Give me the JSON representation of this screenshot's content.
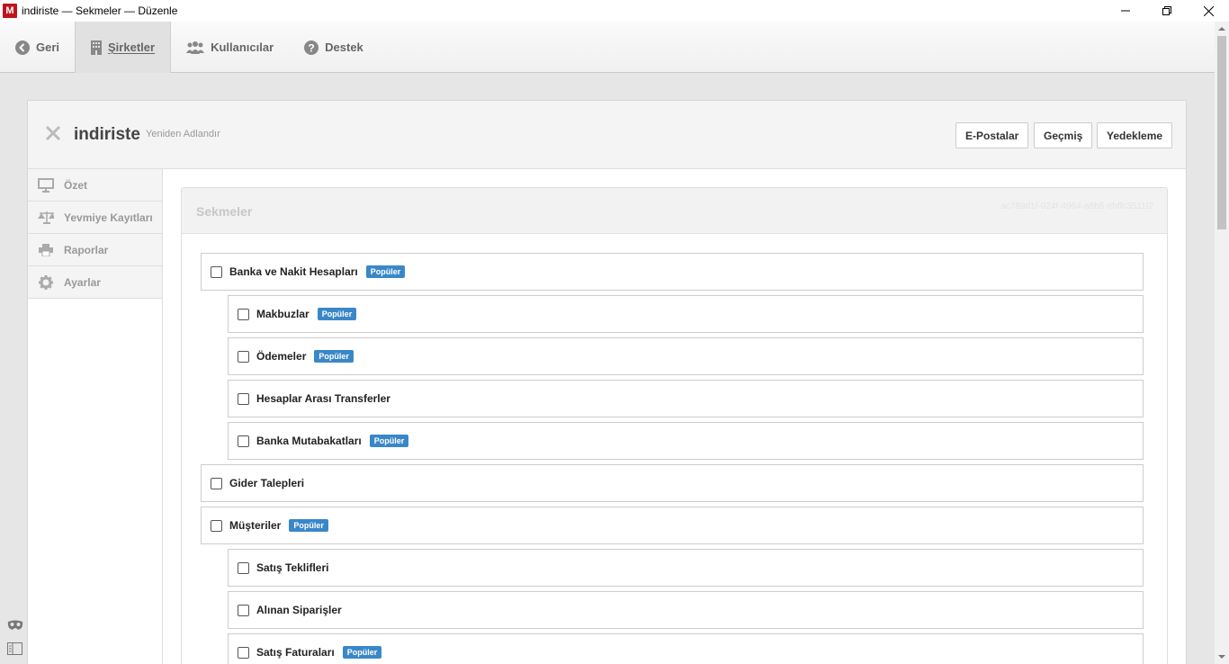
{
  "window": {
    "app_letter": "M",
    "title": "indiriste — Sekmeler — Düzenle"
  },
  "nav": {
    "back": "Geri",
    "companies": "Şirketler",
    "users": "Kullanıcılar",
    "support": "Destek"
  },
  "header": {
    "company": "indiriste",
    "rename": "Yeniden Adlandır",
    "emails": "E-Postalar",
    "history": "Geçmiş",
    "backup": "Yedekleme"
  },
  "sidemenu": {
    "summary": "Özet",
    "journal": "Yevmiye Kayıtları",
    "reports": "Raporlar",
    "settings": "Ayarlar"
  },
  "panel": {
    "title": "Sekmeler",
    "id": "ac789d1f-024f-4964-a8b5-ebffc3511f2"
  },
  "badge_label": "Popüler",
  "tabs": [
    {
      "label": "Banka ve Nakit Hesapları",
      "popular": true,
      "checked": false
    },
    {
      "label": "Makbuzlar",
      "popular": true,
      "checked": false
    },
    {
      "label": "Ödemeler",
      "popular": true,
      "checked": false
    },
    {
      "label": "Hesaplar Arası Transferler",
      "popular": false,
      "checked": false
    },
    {
      "label": "Banka Mutabakatları",
      "popular": true,
      "checked": false
    },
    {
      "label": "Gider Talepleri",
      "popular": false,
      "checked": false
    },
    {
      "label": "Müşteriler",
      "popular": true,
      "checked": false
    },
    {
      "label": "Satış Teklifleri",
      "popular": false,
      "checked": false
    },
    {
      "label": "Alınan Siparişler",
      "popular": false,
      "checked": false
    },
    {
      "label": "Satış Faturaları",
      "popular": true,
      "checked": false
    }
  ]
}
